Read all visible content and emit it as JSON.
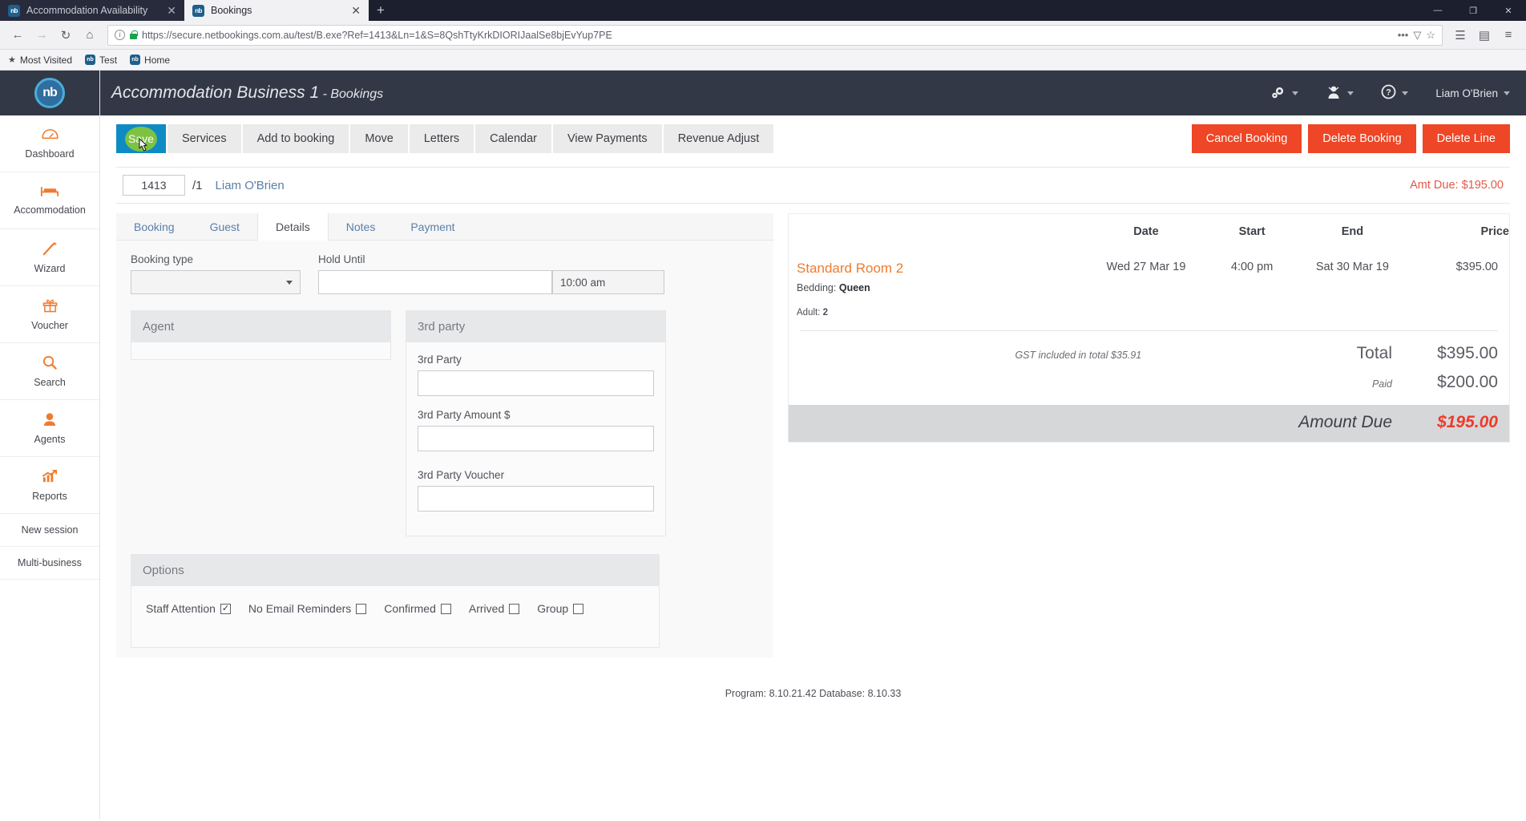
{
  "browser": {
    "tabs": [
      {
        "title": "Accommodation Availability",
        "favicon": "nb",
        "active": false
      },
      {
        "title": "Bookings",
        "favicon": "nb",
        "active": true
      }
    ],
    "new_tab_label": "+",
    "window_controls": {
      "minimize": "—",
      "maximize": "❐",
      "close": "✕"
    },
    "nav": {
      "back": "←",
      "forward": "→",
      "reload": "↻",
      "home": "⌂"
    },
    "url": {
      "scheme": "https://",
      "host": "secure.netbookings.com.au",
      "path": "/test/B.exe?Ref=1413&Ln=1&S=8QshTtyKrkDIORIJaalSe8bjEvYup7PE",
      "full": "https://secure.netbookings.com.au/test/B.exe?Ref=1413&Ln=1&S=8QshTtyKrkDIORIJaalSe8bjEvYup7PE",
      "info_icon": "i",
      "lock_icon": "padlock-icon",
      "more_icon": "•••",
      "pocket_icon": "▽",
      "bookmark_icon": "☆"
    },
    "toolbar_right": {
      "library": "☰",
      "sidebar": "▤",
      "menu": "≡"
    },
    "bookmarks": [
      {
        "label": "Most Visited",
        "icon": "star-icon"
      },
      {
        "label": "Test",
        "icon": "nb"
      },
      {
        "label": "Home",
        "icon": "nb"
      }
    ]
  },
  "sidebar": {
    "logo": "nb",
    "items": [
      {
        "label": "Dashboard",
        "icon": "◔"
      },
      {
        "label": "Accommodation",
        "icon": "Ὤf"
      },
      {
        "label": "Wizard",
        "icon": "✒"
      },
      {
        "label": "Voucher",
        "icon": "Ἰ1"
      },
      {
        "label": "Search",
        "icon": "ὐd"
      },
      {
        "label": "Agents",
        "icon": "὆4"
      },
      {
        "label": "Reports",
        "icon": "Ὄ8"
      }
    ],
    "plain_items": [
      {
        "label": "New session"
      },
      {
        "label": "Multi-business"
      }
    ]
  },
  "header": {
    "business": "Accommodation Business 1",
    "separator": " - ",
    "section": "Bookings",
    "settings_icon": "⚙",
    "user_admin_icon": "♟",
    "help_icon": "?",
    "username": "Liam O'Brien"
  },
  "toolbar": {
    "save_label": "Save",
    "buttons": [
      "Services",
      "Add to booking",
      "Move",
      "Letters",
      "Calendar",
      "View Payments",
      "Revenue Adjust"
    ],
    "danger_buttons": [
      "Cancel Booking",
      "Delete Booking",
      "Delete Line"
    ]
  },
  "refbar": {
    "booking_ref": "1413",
    "line": "/1",
    "guest_name": "Liam O'Brien",
    "amount_due_label": "Amt Due: $195.00"
  },
  "tabs": [
    {
      "label": "Booking",
      "active": false
    },
    {
      "label": "Guest",
      "active": false
    },
    {
      "label": "Details",
      "active": true
    },
    {
      "label": "Notes",
      "active": false
    },
    {
      "label": "Payment",
      "active": false
    }
  ],
  "details_form": {
    "booking_type_label": "Booking type",
    "booking_type_value": "",
    "hold_until_label": "Hold Until",
    "hold_until_value": "",
    "hold_time_value": "10:00 am"
  },
  "agent_pane": {
    "title": "Agent",
    "content": ""
  },
  "third_party_pane": {
    "title": "3rd party",
    "party_label": "3rd Party",
    "party_value": "",
    "amount_label": "3rd Party Amount $",
    "amount_value": "",
    "voucher_label": "3rd Party Voucher",
    "voucher_value": ""
  },
  "options_pane": {
    "title": "Options",
    "checkboxes": [
      {
        "label": "Staff Attention",
        "checked": true
      },
      {
        "label": "No Email Reminders",
        "checked": false
      },
      {
        "label": "Confirmed",
        "checked": false
      },
      {
        "label": "Arrived",
        "checked": false
      },
      {
        "label": "Group",
        "checked": false
      }
    ]
  },
  "summary": {
    "columns": {
      "date": "Date",
      "start": "Start",
      "end": "End",
      "price": "Price"
    },
    "line": {
      "room": "Standard Room 2",
      "bedding_label": "Bedding:",
      "bedding_value": "Queen",
      "adult_label": "Adult:",
      "adult_value": "2",
      "date": "Wed 27 Mar 19",
      "start": "4:00 pm",
      "end": "Sat 30 Mar 19",
      "price": "$395.00"
    },
    "gst_note": "GST included in total $35.91",
    "total_label": "Total",
    "total_value": "$395.00",
    "paid_label": "Paid",
    "paid_value": "$200.00",
    "due_label": "Amount Due",
    "due_value": "$195.00"
  },
  "footer": {
    "text": "Program: 8.10.21.42 Database: 8.10.33"
  },
  "colors": {
    "brand_dark": "#323845",
    "accent_orange": "#ef7b2f",
    "danger_red": "#ee4626",
    "save_blue": "#0f8bc4",
    "save_green": "#7dc242",
    "link_blue": "#5a7fa8"
  }
}
